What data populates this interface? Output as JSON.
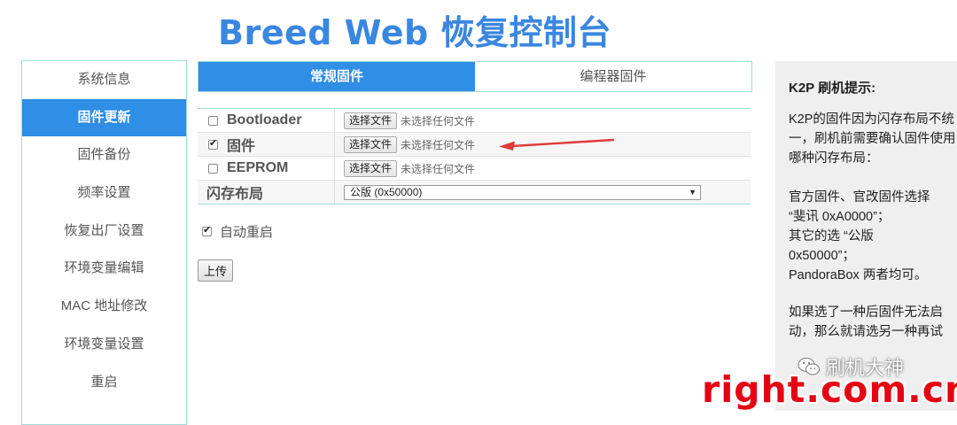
{
  "page": {
    "title": "Breed Web 恢复控制台"
  },
  "sidebar": {
    "items": [
      {
        "label": "系统信息",
        "active": false
      },
      {
        "label": "固件更新",
        "active": true
      },
      {
        "label": "固件备份",
        "active": false
      },
      {
        "label": "频率设置",
        "active": false
      },
      {
        "label": "恢复出厂设置",
        "active": false
      },
      {
        "label": "环境变量编辑",
        "active": false
      },
      {
        "label": "MAC 地址修改",
        "active": false
      },
      {
        "label": "环境变量设置",
        "active": false
      },
      {
        "label": "重启",
        "active": false
      }
    ]
  },
  "tabs": [
    {
      "label": "常规固件",
      "active": true
    },
    {
      "label": "编程器固件",
      "active": false
    }
  ],
  "form": {
    "rows": [
      {
        "label": "Bootloader",
        "checked": false,
        "button": "选择文件",
        "note": "未选择任何文件"
      },
      {
        "label": "固件",
        "checked": true,
        "button": "选择文件",
        "note": "未选择任何文件"
      },
      {
        "label": "EEPROM",
        "checked": false,
        "button": "选择文件",
        "note": "未选择任何文件"
      }
    ],
    "flash_layout": {
      "label": "闪存布局",
      "selected": "公版 (0x50000)"
    }
  },
  "auto_reboot": {
    "label": "自动重启",
    "checked": true
  },
  "upload_button": "上传",
  "tips": {
    "title": "K2P 刷机提示:",
    "para1": "K2P的固件因为闪存布局不统一，刷机前需要确认固件使用哪种闪存布局：",
    "para2_l1": "官方固件、官改固件选择",
    "para2_l2": "“斐讯 0xA0000”；",
    "para2_l3": "其它的选 “公版",
    "para2_l4": "0x50000”；",
    "para2_l5": "PandoraBox 两者均可。",
    "para3": "如果选了一种后固件无法启动，那么就请选另一种再试"
  },
  "watermark": {
    "wechat_name": "刷机大神",
    "site": "right.com.cn"
  },
  "colors": {
    "accent": "#2f8ee5",
    "title": "#3a87e0",
    "annotation_arrow": "#e03a3a",
    "watermark_red": "#e60012"
  }
}
